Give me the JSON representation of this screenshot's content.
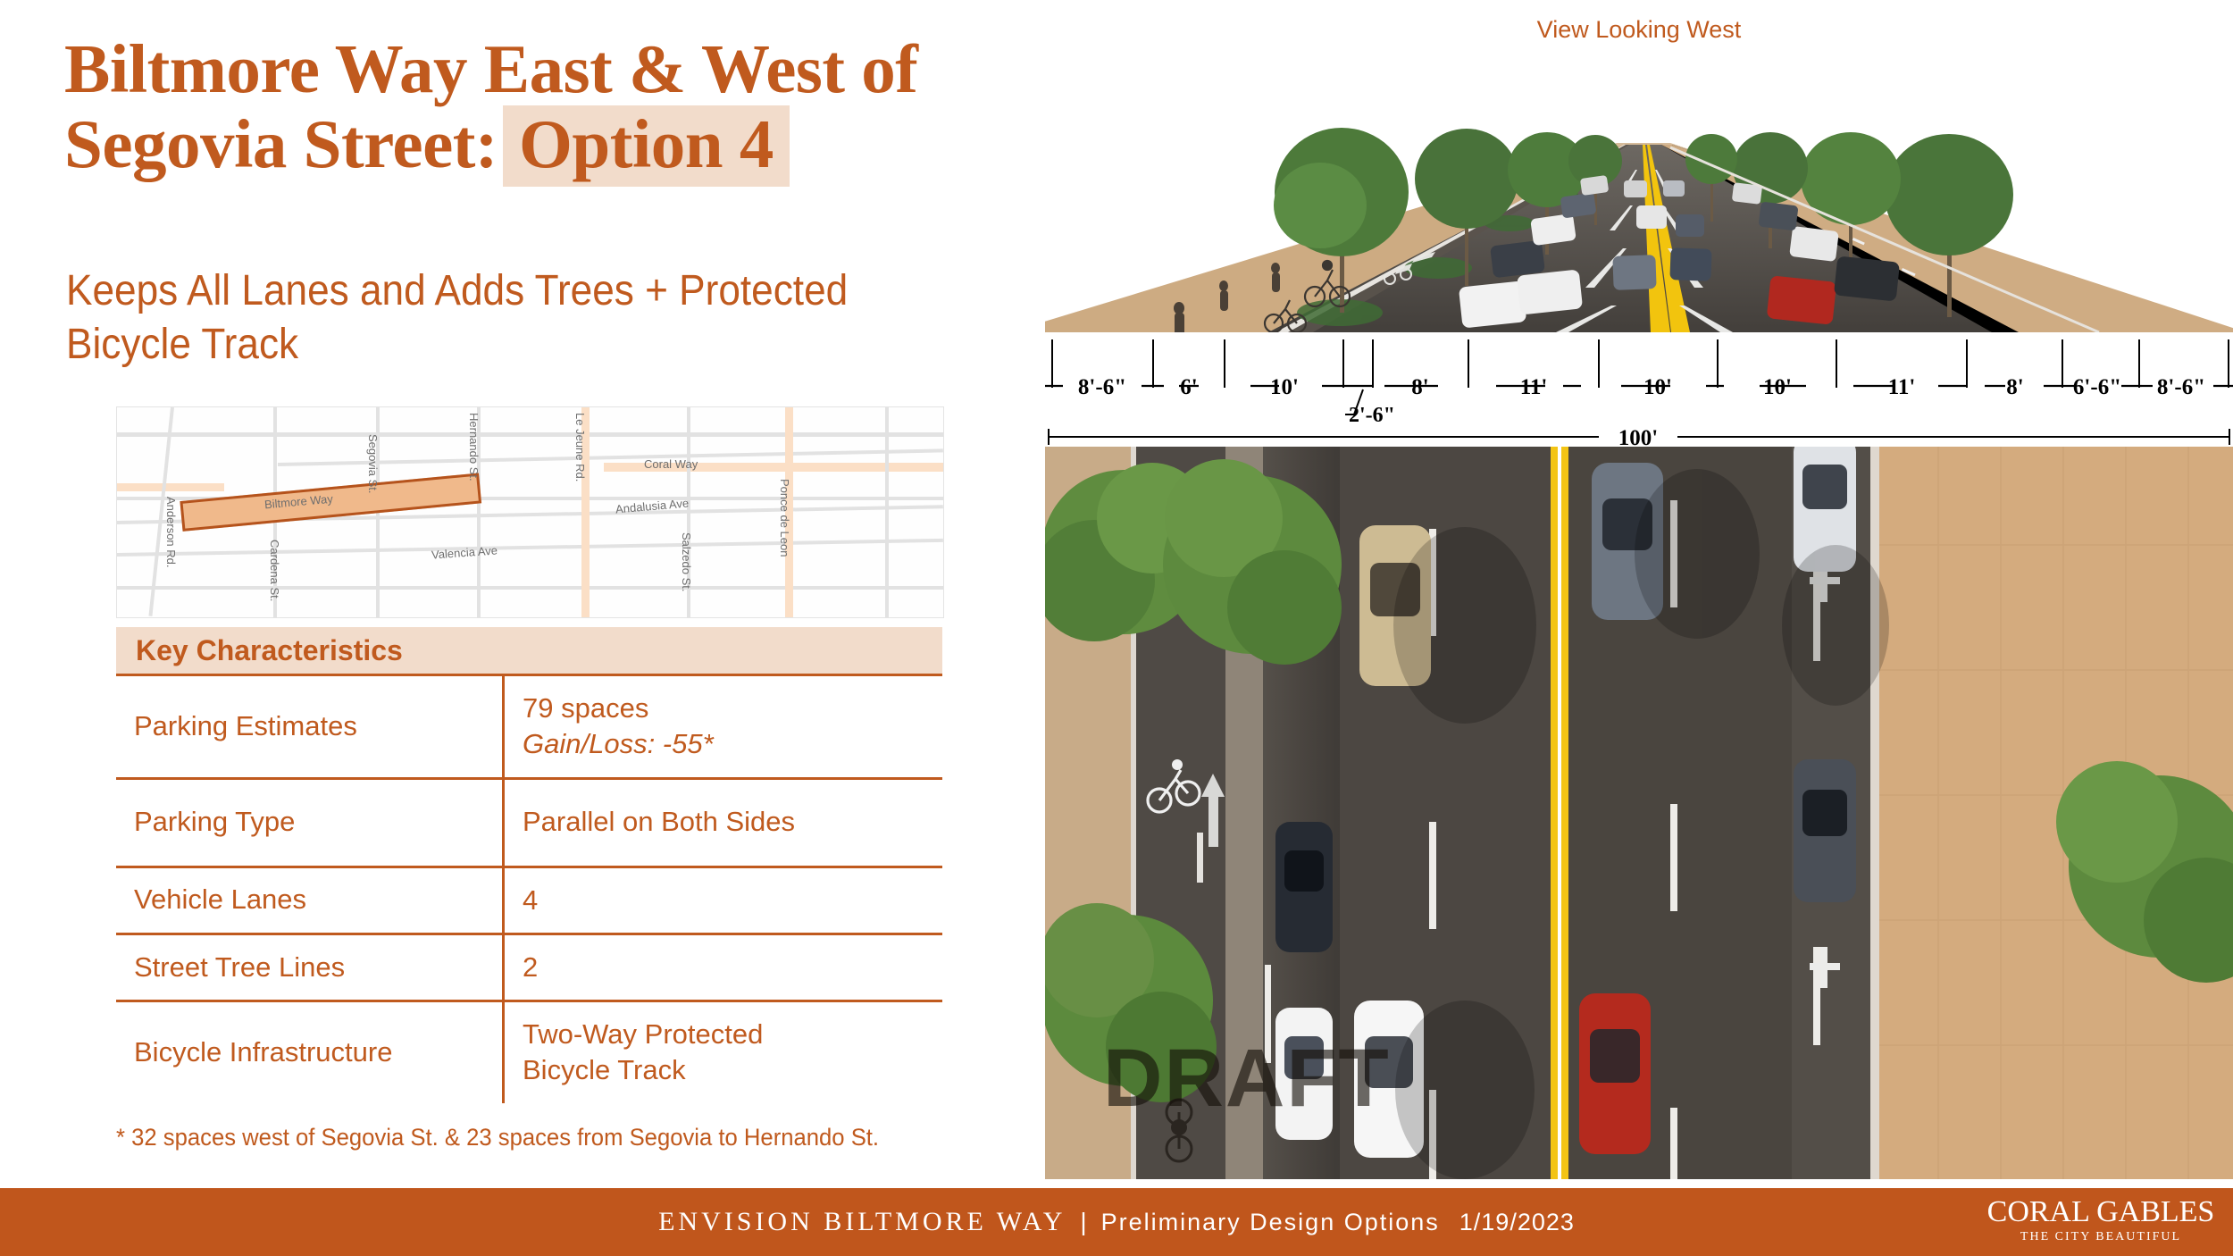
{
  "title": {
    "line1": "Biltmore Way East & West of",
    "line2_prefix": "Segovia Street:",
    "option_badge": "Option 4"
  },
  "subtitle": "Keeps All Lanes and Adds Trees + Protected Bicycle Track",
  "colors": {
    "accent": "#C05A1E",
    "accent_light": "#F2DCCB",
    "footer_bar": "#C0561C",
    "map_major_road": "#FBDFC6",
    "map_minor_road": "#E2E2E2",
    "corridor_fill": "#F0B98B",
    "corridor_stroke": "#B5531C"
  },
  "map": {
    "streets": [
      {
        "name": "Biltmore Way"
      },
      {
        "name": "Segovia St."
      },
      {
        "name": "Hernando St."
      },
      {
        "name": "Le Jeune Rd."
      },
      {
        "name": "Coral Way"
      },
      {
        "name": "Andalusia Ave"
      },
      {
        "name": "Ponce de Leon"
      },
      {
        "name": "Salzedo St."
      },
      {
        "name": "Valencia Ave"
      },
      {
        "name": "Cardena St."
      },
      {
        "name": "Anderson Rd."
      }
    ]
  },
  "table": {
    "header": "Key Characteristics",
    "rows": [
      {
        "label": "Parking Estimates",
        "value": "79 spaces",
        "value2": "Gain/Loss: -55*"
      },
      {
        "label": "Parking Type",
        "value": "Parallel on Both Sides",
        "value2": ""
      },
      {
        "label": "Vehicle Lanes",
        "value": "4",
        "value2": ""
      },
      {
        "label": "Street Tree Lines",
        "value": "2",
        "value2": ""
      },
      {
        "label": "Bicycle Infrastructure",
        "value": "Two-Way Protected",
        "value2": "Bicycle Track"
      }
    ],
    "footnote": "* 32 spaces west of Segovia St. & 23 spaces from Segovia to Hernando St."
  },
  "rendering": {
    "view_label": "View Looking West",
    "watermark": "DRAFT"
  },
  "cross_section": {
    "total_label": "100'",
    "segments": [
      {
        "label": "8'-6\"",
        "width_ft": 8.5
      },
      {
        "label": "6'",
        "width_ft": 6
      },
      {
        "label": "10'",
        "width_ft": 10
      },
      {
        "label": "2'-6\"",
        "width_ft": 2.5
      },
      {
        "label": "8'",
        "width_ft": 8
      },
      {
        "label": "11'",
        "width_ft": 11
      },
      {
        "label": "10'",
        "width_ft": 10
      },
      {
        "label": "10'",
        "width_ft": 10
      },
      {
        "label": "11'",
        "width_ft": 11
      },
      {
        "label": "8'",
        "width_ft": 8
      },
      {
        "label": "6'-6\"",
        "width_ft": 6.5
      },
      {
        "label": "8'-6\"",
        "width_ft": 8.5
      }
    ]
  },
  "footer": {
    "project": "ENVISION BILTMORE WAY",
    "separator": "|",
    "phase": "Preliminary Design Options",
    "date": "1/19/2023",
    "logo_line1": "CORAL GABLES",
    "logo_line2": "THE CITY BEAUTIFUL"
  }
}
